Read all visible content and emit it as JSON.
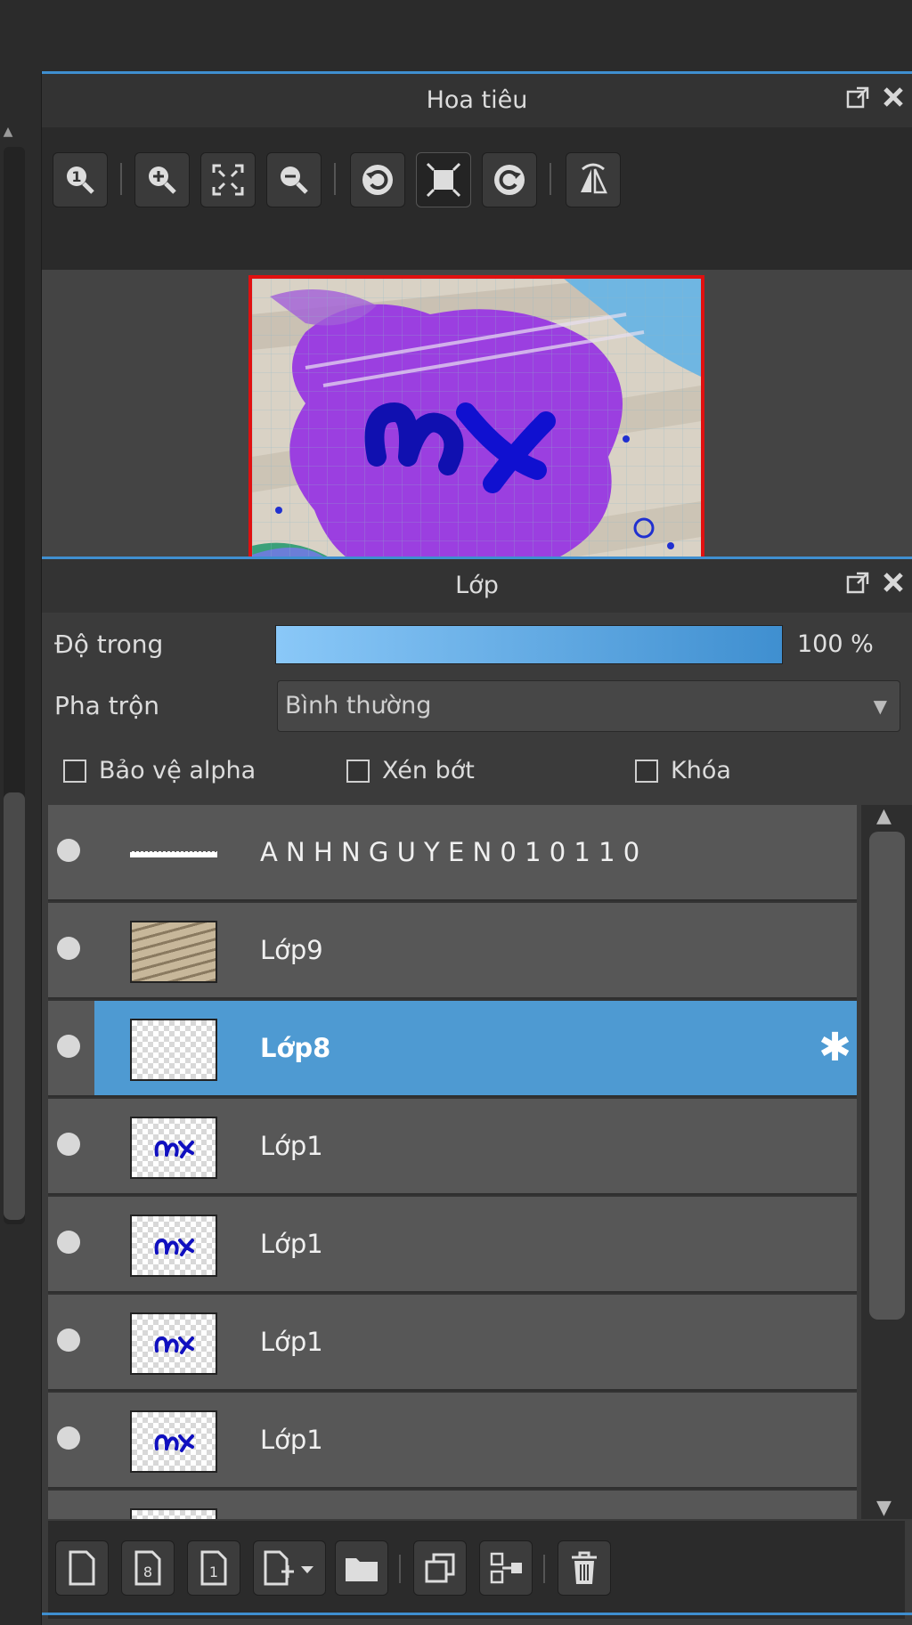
{
  "navigator": {
    "title": "Hoa tiêu",
    "toolbar": [
      {
        "icon": "zoom-actual-icon"
      },
      {
        "icon": "zoom-in-icon"
      },
      {
        "icon": "fit-screen-icon"
      },
      {
        "icon": "zoom-out-icon"
      },
      {
        "icon": "rotate-left-icon"
      },
      {
        "icon": "fit-window-icon"
      },
      {
        "icon": "rotate-right-icon"
      },
      {
        "icon": "flip-horizontal-icon"
      }
    ]
  },
  "layers_panel": {
    "title": "Lớp",
    "opacity_label": "Độ trong",
    "opacity_value": "100 %",
    "opacity_level": 1.0,
    "blend_label": "Pha trộn",
    "blend_value": "Bình thường",
    "checkboxes": {
      "protect_alpha": "Bảo vệ alpha",
      "clipping": "Xén bớt",
      "lock": "Khóa"
    },
    "layers": [
      {
        "name": "A N H N G U Y E N 0 1 0 1 1 0",
        "thumb": "text",
        "selected": false
      },
      {
        "name": "Lớp9",
        "thumb": "photo",
        "selected": false
      },
      {
        "name": "Lớp8",
        "thumb": "empty",
        "selected": true
      },
      {
        "name": "Lớp1",
        "thumb": "logo",
        "selected": false
      },
      {
        "name": "Lớp1",
        "thumb": "logo",
        "selected": false
      },
      {
        "name": "Lớp1",
        "thumb": "logo",
        "selected": false
      },
      {
        "name": "Lớp1",
        "thumb": "logo",
        "selected": false
      }
    ],
    "bottom_toolbar": [
      {
        "icon": "new-layer-icon"
      },
      {
        "icon": "new-8bit-layer-icon"
      },
      {
        "icon": "new-1bit-layer-icon"
      },
      {
        "icon": "add-layer-dropdown-icon"
      },
      {
        "icon": "folder-icon"
      },
      {
        "icon": "duplicate-layer-icon"
      },
      {
        "icon": "merge-down-icon"
      },
      {
        "icon": "trash-icon"
      }
    ]
  },
  "colors": {
    "accent": "#3f8fd0",
    "selected_row": "#4e9ad2",
    "preview_border": "#e01010"
  }
}
